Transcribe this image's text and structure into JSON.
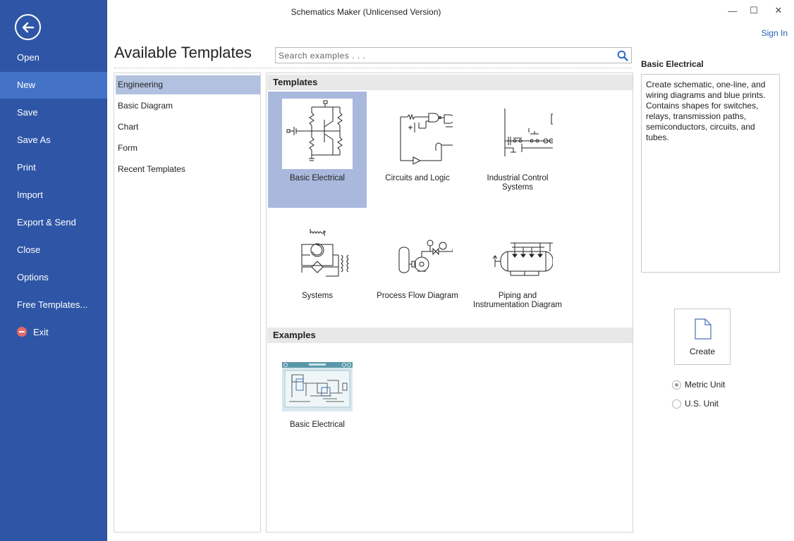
{
  "window": {
    "title": "Schematics Maker (Unlicensed Version)",
    "minimize_glyph": "—",
    "maximize_glyph": "☐",
    "close_glyph": "✕",
    "sign_in": "Sign In"
  },
  "nav": {
    "back_icon": "back-arrow-icon",
    "items": [
      {
        "label": "Open"
      },
      {
        "label": "New"
      },
      {
        "label": "Save"
      },
      {
        "label": "Save As"
      },
      {
        "label": "Print"
      },
      {
        "label": "Import"
      },
      {
        "label": "Export & Send"
      },
      {
        "label": "Close"
      },
      {
        "label": "Options"
      },
      {
        "label": "Free Templates..."
      },
      {
        "label": "Exit"
      }
    ],
    "active": "New",
    "colors": {
      "background": "#2f56a6",
      "active": "#4372c6"
    }
  },
  "main": {
    "heading": "Available Templates",
    "search": {
      "placeholder": "Search examples . . .",
      "icon": "search-icon"
    },
    "categories": [
      "Engineering",
      "Basic Diagram",
      "Chart",
      "Form",
      "Recent Templates"
    ],
    "selected_category": "Engineering",
    "templates_header": "Templates",
    "templates": [
      {
        "label": "Basic Electrical",
        "selected": true
      },
      {
        "label": "Circuits and Logic"
      },
      {
        "label": "Industrial Control Systems"
      },
      {
        "label": "Systems"
      },
      {
        "label": "Process Flow Diagram"
      },
      {
        "label": "Piping and Instrumentation Diagram"
      }
    ],
    "examples_header": "Examples",
    "examples": [
      {
        "label": "Basic Electrical"
      }
    ]
  },
  "details": {
    "title": "Basic Electrical",
    "description": "Create schematic, one-line, and wiring diagrams and blue prints. Contains shapes for switches, relays, transmission paths, semiconductors, circuits, and tubes.",
    "create_label": "Create",
    "units": [
      {
        "label": "Metric Unit",
        "checked": true
      },
      {
        "label": "U.S. Unit",
        "checked": false
      }
    ]
  }
}
